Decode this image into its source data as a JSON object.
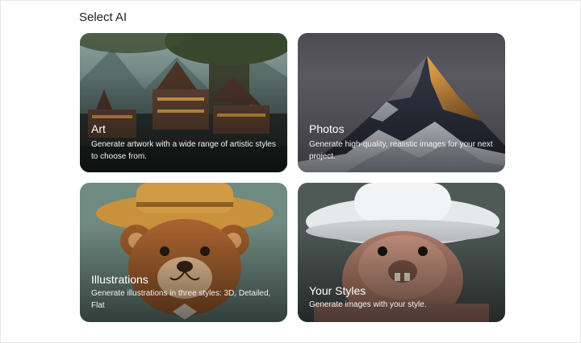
{
  "heading": "Select AI",
  "cards": [
    {
      "title": "Art",
      "description": "Generate artwork with a wide range of artistic styles to choose from.",
      "image": "fantasy-treehouse-village"
    },
    {
      "title": "Photos",
      "description": "Generate high-quality, realistic images for your next project.",
      "image": "snowy-mountain-peak"
    },
    {
      "title": "Illustrations",
      "description": "Generate illustrations in three styles: 3D, Detailed, Flat",
      "image": "cartoon-teddy-bear-cowboy-hat"
    },
    {
      "title": "Your Styles",
      "description": "Generate images with your style.",
      "image": "knitted-bear-with-hat"
    }
  ]
}
